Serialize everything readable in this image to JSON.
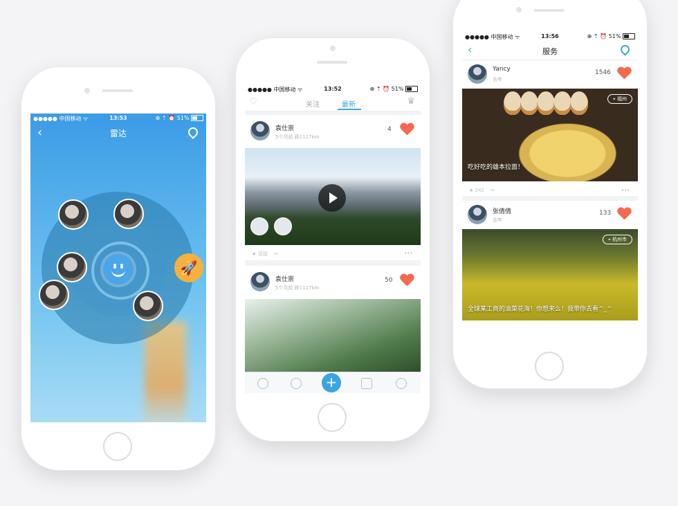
{
  "status": {
    "carrier": "●●●●● 中国移动 ᯤ",
    "battery": "51%",
    "icons": "⊕ ⇡ ⏰"
  },
  "phone1": {
    "time": "13:53",
    "title": "雷达",
    "back": "‹"
  },
  "phone2": {
    "time": "13:52",
    "tabs": [
      "关注",
      "最新"
    ],
    "posts": [
      {
        "name": "袁仕崇",
        "meta": "5个月前  距1117km",
        "count": "4",
        "actions": "活动",
        "more": "•••"
      },
      {
        "name": "袁仕崇",
        "meta": "5个月前  距1117km",
        "count": "50"
      }
    ],
    "plus": "+"
  },
  "phone3": {
    "time": "13:56",
    "title": "服务",
    "back": "‹",
    "posts": [
      {
        "name": "Yancy",
        "meta": "去年",
        "count": "1546",
        "location": "福州",
        "caption": "吃好吃的雄本拉面！",
        "stars": "242",
        "more": "•••"
      },
      {
        "name": "张倩倩",
        "meta": "去年",
        "count": "133",
        "location": "杭州市",
        "caption": "全球某工商的油菜花海！你想来么！我带你去看^_^"
      }
    ]
  },
  "colors": {
    "accent": "#3aa5e0",
    "heart": "#f26a50",
    "rocket": "#f5b13d"
  }
}
